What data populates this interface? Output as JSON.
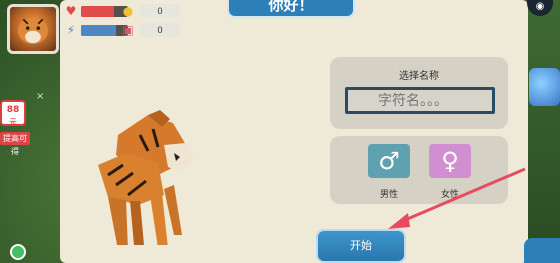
{
  "title": "你好！",
  "hud": {
    "health_value": "0",
    "energy_value": "0",
    "health_level": 0.7,
    "energy_level": 0.75
  },
  "form": {
    "name_label": "选择名称",
    "name_placeholder": "字符名。。。",
    "male_label": "男性",
    "female_label": "女性",
    "male_symbol": "♂",
    "female_symbol": "♀"
  },
  "start_label": "开始",
  "side": {
    "promo_amount": "88",
    "promo_unit": "元",
    "promo_caption": "提高可得",
    "close": "×",
    "bottom_text": ""
  },
  "colors": {
    "panel": "#efe9d8",
    "title_tab": "#2d7fb7",
    "male": "#5fa0b1",
    "female": "#d18fd1",
    "start": "#2a78ad",
    "health_bar": "#e04b4b",
    "energy_bar": "#4e87c4",
    "arrow": "#e84a5f"
  }
}
